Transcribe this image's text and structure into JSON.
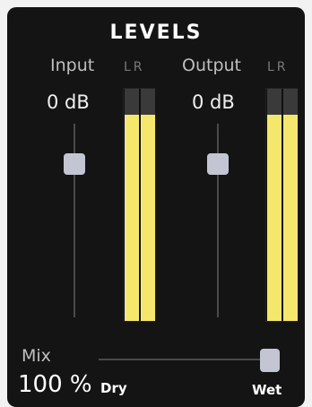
{
  "title": "LEVELS",
  "input": {
    "label": "Input",
    "lr": "LR",
    "value": "0 dB",
    "slider_level": 0.83,
    "meter": {
      "left": 0.89,
      "right": 0.89
    }
  },
  "output": {
    "label": "Output",
    "lr": "LR",
    "value": "0 dB",
    "slider_level": 0.83,
    "meter": {
      "left": 0.89,
      "right": 0.89
    }
  },
  "mix": {
    "label": "Mix",
    "value": "100 %",
    "dry_label": "Dry",
    "wet_label": "Wet",
    "position": 1.0
  },
  "colors": {
    "panel": "#141414",
    "meter_fill": "#f4e76b",
    "thumb": "#c3c6d2"
  }
}
